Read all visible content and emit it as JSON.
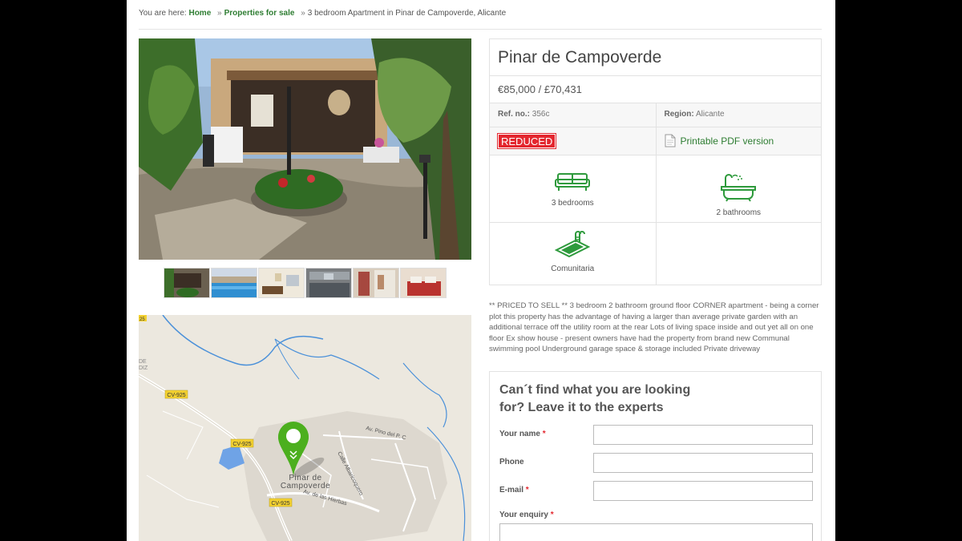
{
  "breadcrumb": {
    "prefix": "You are here:",
    "home": "Home",
    "sep1": "»",
    "for_sale": "Properties for sale",
    "sep2": "»",
    "current": "3 bedroom Apartment in Pinar de Campoverde, Alicante"
  },
  "property": {
    "title": "Pinar de Campoverde",
    "price": "€85,000 / £70,431",
    "ref_label": "Ref. no.:",
    "ref_value": "356c",
    "region_label": "Region:",
    "region_value": "Alicante",
    "badge": "REDUCED",
    "pdf_link": "Printable PDF version"
  },
  "features": [
    {
      "icon": "sofa-icon",
      "label": "3 bedrooms"
    },
    {
      "icon": "bathtub-icon",
      "label": "2 bathrooms"
    },
    {
      "icon": "pool-icon",
      "label": "Comunitaria"
    }
  ],
  "description": "** PRICED TO SELL ** 3 bedroom 2 bathroom ground floor CORNER apartment - being a corner plot this property has the advantage of having a larger than average private garden with an additional terrace off the utility room at the rear Lots of living space inside and out yet all on one floor Ex show house - present owners have had the property from brand new Communal swimming pool Underground garage space & storage included Private driveway",
  "map": {
    "place_line1": "Pinar de",
    "place_line2": "Campoverde",
    "roads": [
      "CV-925",
      "CV-925",
      "CV-925"
    ],
    "streets": [
      "Av. Pino del P. C",
      "Calle Albaricoquero",
      "Av. de las Hierbas"
    ],
    "edge_label_top": "25",
    "edge_label_left1": "DE",
    "edge_label_left2": "DIZ"
  },
  "enquiry": {
    "heading": "Can´t find what you are looking for?  Leave it to the experts",
    "name_label": "Your name",
    "phone_label": "Phone",
    "email_label": "E-mail",
    "enquiry_label": "Your enquiry",
    "required_mark": "*"
  },
  "colors": {
    "accent_green": "#2e7d32",
    "reduced_red": "#e3262e",
    "map_pin": "#4caf1e"
  }
}
